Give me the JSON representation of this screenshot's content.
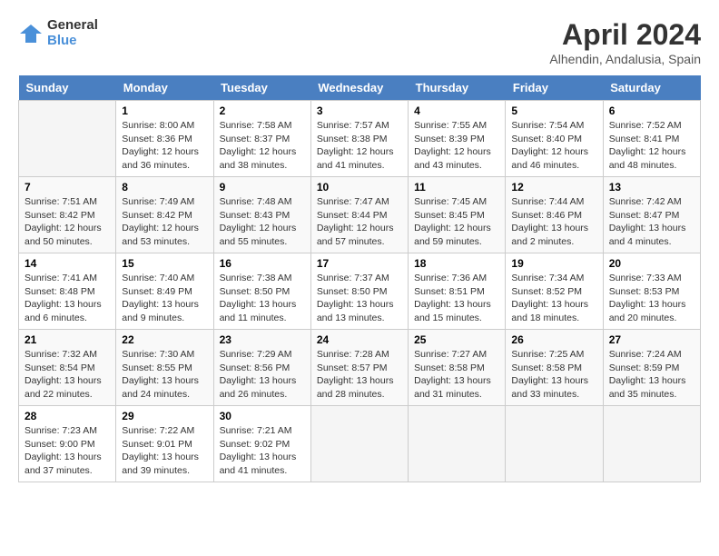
{
  "header": {
    "logo_line1": "General",
    "logo_line2": "Blue",
    "month": "April 2024",
    "location": "Alhendin, Andalusia, Spain"
  },
  "columns": [
    "Sunday",
    "Monday",
    "Tuesday",
    "Wednesday",
    "Thursday",
    "Friday",
    "Saturday"
  ],
  "weeks": [
    [
      {
        "num": "",
        "info": ""
      },
      {
        "num": "1",
        "info": "Sunrise: 8:00 AM\nSunset: 8:36 PM\nDaylight: 12 hours\nand 36 minutes."
      },
      {
        "num": "2",
        "info": "Sunrise: 7:58 AM\nSunset: 8:37 PM\nDaylight: 12 hours\nand 38 minutes."
      },
      {
        "num": "3",
        "info": "Sunrise: 7:57 AM\nSunset: 8:38 PM\nDaylight: 12 hours\nand 41 minutes."
      },
      {
        "num": "4",
        "info": "Sunrise: 7:55 AM\nSunset: 8:39 PM\nDaylight: 12 hours\nand 43 minutes."
      },
      {
        "num": "5",
        "info": "Sunrise: 7:54 AM\nSunset: 8:40 PM\nDaylight: 12 hours\nand 46 minutes."
      },
      {
        "num": "6",
        "info": "Sunrise: 7:52 AM\nSunset: 8:41 PM\nDaylight: 12 hours\nand 48 minutes."
      }
    ],
    [
      {
        "num": "7",
        "info": "Sunrise: 7:51 AM\nSunset: 8:42 PM\nDaylight: 12 hours\nand 50 minutes."
      },
      {
        "num": "8",
        "info": "Sunrise: 7:49 AM\nSunset: 8:42 PM\nDaylight: 12 hours\nand 53 minutes."
      },
      {
        "num": "9",
        "info": "Sunrise: 7:48 AM\nSunset: 8:43 PM\nDaylight: 12 hours\nand 55 minutes."
      },
      {
        "num": "10",
        "info": "Sunrise: 7:47 AM\nSunset: 8:44 PM\nDaylight: 12 hours\nand 57 minutes."
      },
      {
        "num": "11",
        "info": "Sunrise: 7:45 AM\nSunset: 8:45 PM\nDaylight: 12 hours\nand 59 minutes."
      },
      {
        "num": "12",
        "info": "Sunrise: 7:44 AM\nSunset: 8:46 PM\nDaylight: 13 hours\nand 2 minutes."
      },
      {
        "num": "13",
        "info": "Sunrise: 7:42 AM\nSunset: 8:47 PM\nDaylight: 13 hours\nand 4 minutes."
      }
    ],
    [
      {
        "num": "14",
        "info": "Sunrise: 7:41 AM\nSunset: 8:48 PM\nDaylight: 13 hours\nand 6 minutes."
      },
      {
        "num": "15",
        "info": "Sunrise: 7:40 AM\nSunset: 8:49 PM\nDaylight: 13 hours\nand 9 minutes."
      },
      {
        "num": "16",
        "info": "Sunrise: 7:38 AM\nSunset: 8:50 PM\nDaylight: 13 hours\nand 11 minutes."
      },
      {
        "num": "17",
        "info": "Sunrise: 7:37 AM\nSunset: 8:50 PM\nDaylight: 13 hours\nand 13 minutes."
      },
      {
        "num": "18",
        "info": "Sunrise: 7:36 AM\nSunset: 8:51 PM\nDaylight: 13 hours\nand 15 minutes."
      },
      {
        "num": "19",
        "info": "Sunrise: 7:34 AM\nSunset: 8:52 PM\nDaylight: 13 hours\nand 18 minutes."
      },
      {
        "num": "20",
        "info": "Sunrise: 7:33 AM\nSunset: 8:53 PM\nDaylight: 13 hours\nand 20 minutes."
      }
    ],
    [
      {
        "num": "21",
        "info": "Sunrise: 7:32 AM\nSunset: 8:54 PM\nDaylight: 13 hours\nand 22 minutes."
      },
      {
        "num": "22",
        "info": "Sunrise: 7:30 AM\nSunset: 8:55 PM\nDaylight: 13 hours\nand 24 minutes."
      },
      {
        "num": "23",
        "info": "Sunrise: 7:29 AM\nSunset: 8:56 PM\nDaylight: 13 hours\nand 26 minutes."
      },
      {
        "num": "24",
        "info": "Sunrise: 7:28 AM\nSunset: 8:57 PM\nDaylight: 13 hours\nand 28 minutes."
      },
      {
        "num": "25",
        "info": "Sunrise: 7:27 AM\nSunset: 8:58 PM\nDaylight: 13 hours\nand 31 minutes."
      },
      {
        "num": "26",
        "info": "Sunrise: 7:25 AM\nSunset: 8:58 PM\nDaylight: 13 hours\nand 33 minutes."
      },
      {
        "num": "27",
        "info": "Sunrise: 7:24 AM\nSunset: 8:59 PM\nDaylight: 13 hours\nand 35 minutes."
      }
    ],
    [
      {
        "num": "28",
        "info": "Sunrise: 7:23 AM\nSunset: 9:00 PM\nDaylight: 13 hours\nand 37 minutes."
      },
      {
        "num": "29",
        "info": "Sunrise: 7:22 AM\nSunset: 9:01 PM\nDaylight: 13 hours\nand 39 minutes."
      },
      {
        "num": "30",
        "info": "Sunrise: 7:21 AM\nSunset: 9:02 PM\nDaylight: 13 hours\nand 41 minutes."
      },
      {
        "num": "",
        "info": ""
      },
      {
        "num": "",
        "info": ""
      },
      {
        "num": "",
        "info": ""
      },
      {
        "num": "",
        "info": ""
      }
    ]
  ]
}
